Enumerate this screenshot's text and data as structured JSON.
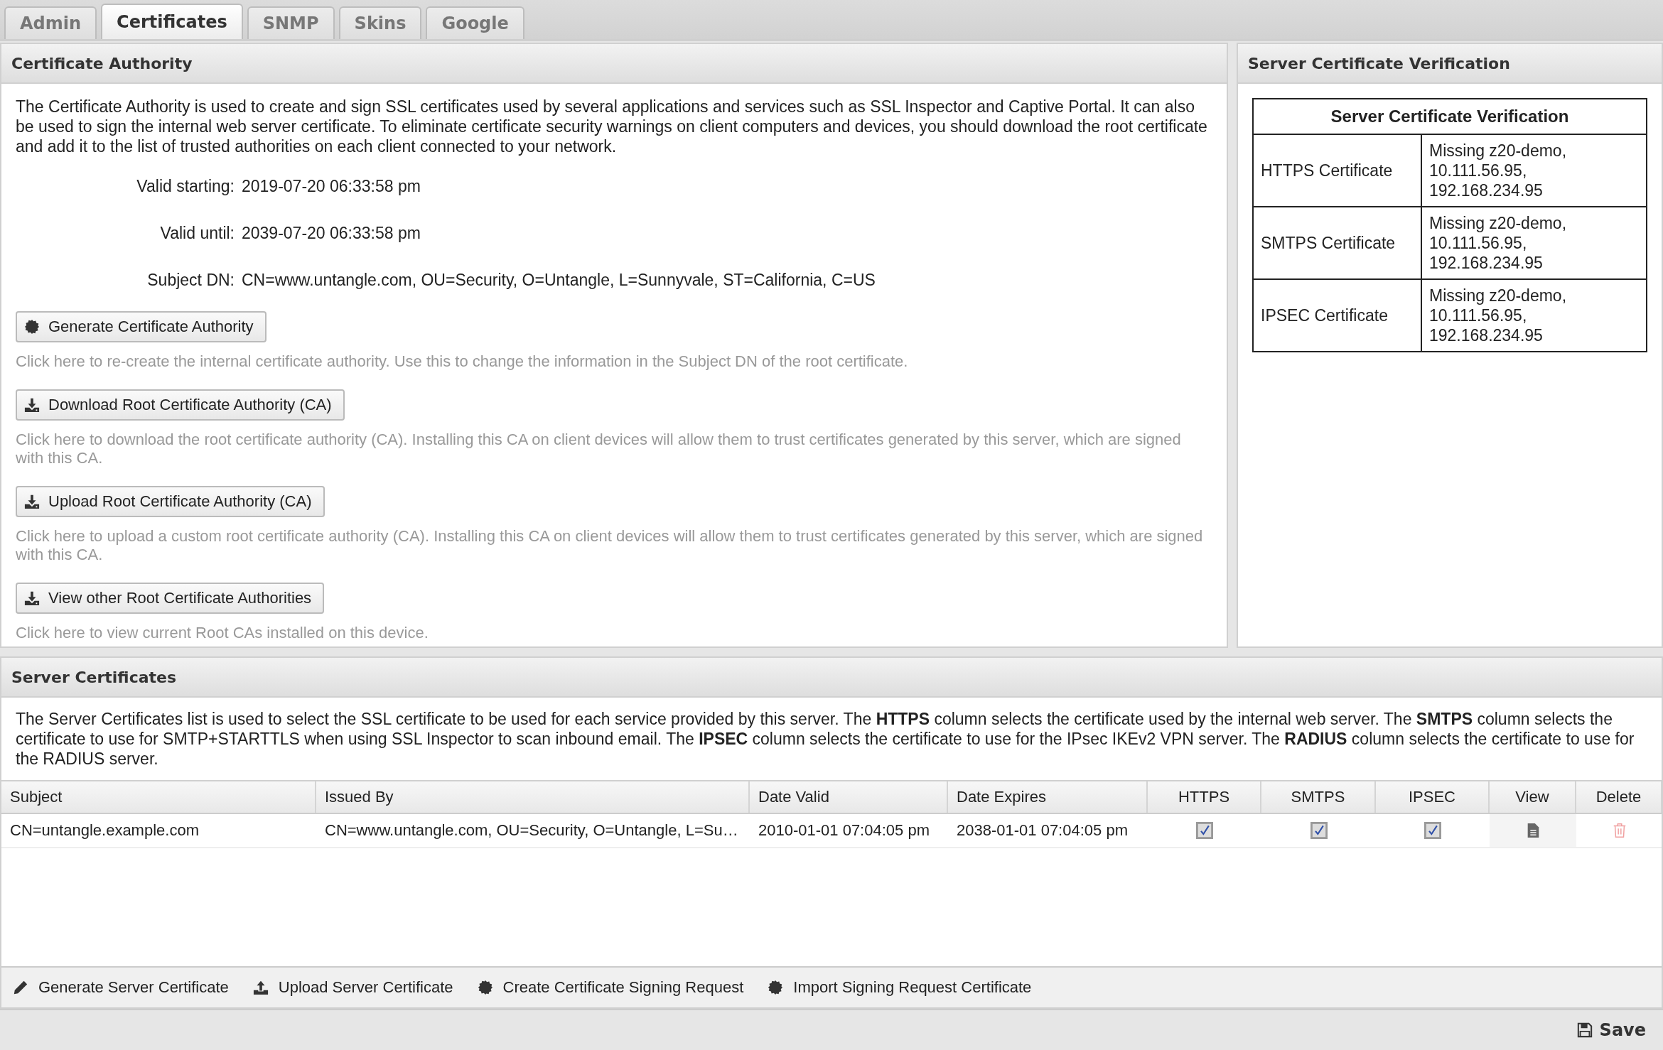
{
  "tabs": [
    {
      "label": "Admin",
      "selected": false
    },
    {
      "label": "Certificates",
      "selected": true
    },
    {
      "label": "SNMP",
      "selected": false
    },
    {
      "label": "Skins",
      "selected": false
    },
    {
      "label": "Google",
      "selected": false
    }
  ],
  "certificate_authority": {
    "title": "Certificate Authority",
    "description": "The Certificate Authority is used to create and sign SSL certificates used by several applications and services such as SSL Inspector and Captive Portal. It can also be used to sign the internal web server certificate. To eliminate certificate security warnings on client computers and devices, you should download the root certificate and add it to the list of trusted authorities on each client connected to your network.",
    "fields": [
      {
        "label": "Valid starting:",
        "value": "2019-07-20 06:33:58 pm"
      },
      {
        "label": "Valid until:",
        "value": "2039-07-20 06:33:58 pm"
      },
      {
        "label": "Subject DN:",
        "value": "CN=www.untangle.com, OU=Security, O=Untangle, L=Sunnyvale, ST=California, C=US"
      }
    ],
    "actions": [
      {
        "label": "Generate Certificate Authority",
        "kind": "seal",
        "hint": "Click here to re-create the internal certificate authority. Use this to change the information in the Subject DN of the root certificate."
      },
      {
        "label": "Download Root Certificate Authority (CA)",
        "kind": "download",
        "hint": "Click here to download the root certificate authority (CA). Installing this CA on client devices will allow them to trust certificates generated by this server, which are signed with this CA."
      },
      {
        "label": "Upload Root Certificate Authority (CA)",
        "kind": "download",
        "hint": "Click here to upload a custom root certificate authority (CA). Installing this CA on client devices will allow them to trust certificates generated by this server, which are signed with this CA."
      },
      {
        "label": "View other Root Certificate Authorities",
        "kind": "download",
        "hint": "Click here to view current Root CAs installed on this device."
      }
    ]
  },
  "verification": {
    "title": "Server Certificate Verification",
    "table_title": "Server Certificate Verification",
    "rows": [
      {
        "label": "HTTPS Certificate",
        "status": "Missing z20-demo, 10.111.56.95, 192.168.234.95"
      },
      {
        "label": "SMTPS Certificate",
        "status": "Missing z20-demo, 10.111.56.95, 192.168.234.95"
      },
      {
        "label": "IPSEC Certificate",
        "status": "Missing z20-demo, 10.111.56.95, 192.168.234.95"
      }
    ]
  },
  "server_certificates": {
    "title": "Server Certificates",
    "description": "The Server Certificates list is used to select the SSL certificate to be used for each service provided by this server. The **HTTPS** column selects the certificate used by the internal web server. The **SMTPS** column selects the certificate to use for SMTP+STARTTLS when using SSL Inspector to scan inbound email. The **IPSEC** column selects the certificate to use for the IPsec IKEv2 VPN server. The **RADIUS** column selects the certificate to use for the RADIUS server.",
    "columns": [
      "Subject",
      "Issued By",
      "Date Valid",
      "Date Expires",
      "HTTPS",
      "SMTPS",
      "IPSEC",
      "View",
      "Delete"
    ],
    "rows": [
      {
        "subject": "CN=untangle.example.com",
        "issued_by": "CN=www.untangle.com, OU=Security, O=Untangle, L=Su…",
        "date_valid": "2010-01-01 07:04:05 pm",
        "date_expires": "2038-01-01 07:04:05 pm",
        "https": true,
        "smtps": true,
        "ipsec": true
      }
    ],
    "toolbar": [
      {
        "label": "Generate Server Certificate",
        "kind": "pencil"
      },
      {
        "label": "Upload Server Certificate",
        "kind": "upload"
      },
      {
        "label": "Create Certificate Signing Request",
        "kind": "seal"
      },
      {
        "label": "Import Signing Request Certificate",
        "kind": "seal"
      }
    ]
  },
  "save_button": {
    "label": "Save"
  }
}
